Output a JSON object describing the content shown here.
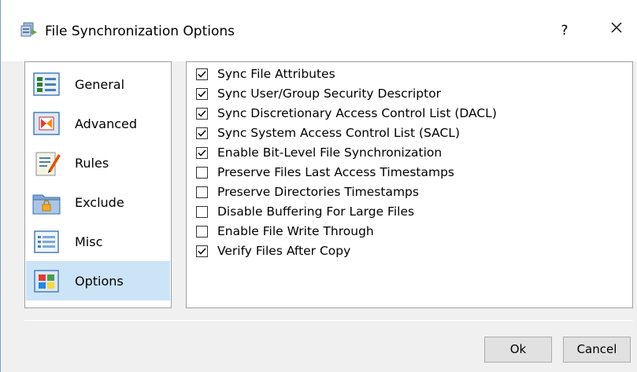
{
  "window": {
    "title": "File Synchronization Options",
    "help_label": "?",
    "close_label": "✕"
  },
  "nav": {
    "items": [
      {
        "label": "General",
        "icon": "general-icon",
        "selected": false
      },
      {
        "label": "Advanced",
        "icon": "advanced-icon",
        "selected": false
      },
      {
        "label": "Rules",
        "icon": "rules-icon",
        "selected": false
      },
      {
        "label": "Exclude",
        "icon": "exclude-icon",
        "selected": false
      },
      {
        "label": "Misc",
        "icon": "misc-icon",
        "selected": false
      },
      {
        "label": "Options",
        "icon": "options-icon",
        "selected": true
      }
    ]
  },
  "options": [
    {
      "label": "Sync File Attributes",
      "checked": true
    },
    {
      "label": "Sync User/Group Security Descriptor",
      "checked": true
    },
    {
      "label": "Sync Discretionary Access Control List (DACL)",
      "checked": true
    },
    {
      "label": "Sync System Access Control List (SACL)",
      "checked": true
    },
    {
      "label": "Enable Bit-Level File Synchronization",
      "checked": true
    },
    {
      "label": "Preserve Files Last Access Timestamps",
      "checked": false
    },
    {
      "label": "Preserve Directories Timestamps",
      "checked": false
    },
    {
      "label": "Disable Buffering For Large Files",
      "checked": false
    },
    {
      "label": "Enable File Write Through",
      "checked": false
    },
    {
      "label": "Verify Files After Copy",
      "checked": true
    }
  ],
  "buttons": {
    "ok_label": "Ok",
    "cancel_label": "Cancel"
  },
  "colors": {
    "selection": "#cce4f7",
    "window_border": "#7a9ccc"
  }
}
